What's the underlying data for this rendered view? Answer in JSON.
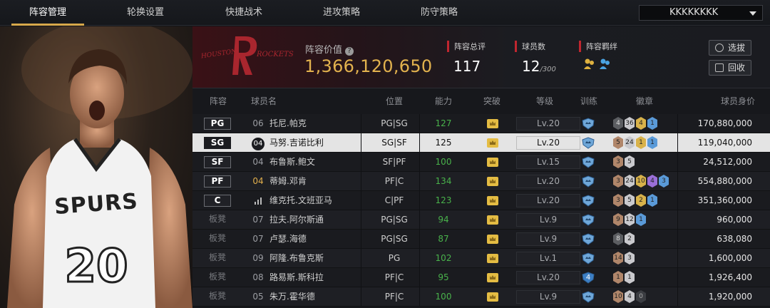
{
  "tabs": [
    {
      "label": "阵容管理",
      "active": true
    },
    {
      "label": "轮换设置",
      "active": false
    },
    {
      "label": "快捷战术",
      "active": false
    },
    {
      "label": "进攻策略",
      "active": false
    },
    {
      "label": "防守策略",
      "active": false
    }
  ],
  "team_select": {
    "value": "KKKKKKKK"
  },
  "header": {
    "value_label": "阵容价值",
    "value": "1,366,120,650",
    "rating_label": "阵容总评",
    "rating": "117",
    "count_label": "球员数",
    "count": "12",
    "count_max": "/300",
    "bond_label": "阵容羁绊",
    "select_button": "选拔",
    "return_button": "回收",
    "logo_text_left": "HOUSTON",
    "logo_text_right": "ROCKETS"
  },
  "player_art": {
    "jersey_text": "SPURS",
    "jersey_number": "20"
  },
  "table": {
    "columns": [
      "阵容",
      "球员名",
      "位置",
      "能力",
      "突破",
      "等级",
      "训练",
      "徽章",
      "球员身价"
    ],
    "rows": [
      {
        "slot": "PG",
        "num": "06",
        "name": "托尼.帕克",
        "pos": "PG|SG",
        "ability": "127",
        "level": "Lv.20",
        "train": "",
        "badges": [
          [
            "gray",
            "4"
          ],
          [
            "silver",
            "36"
          ],
          [
            "gold",
            "4"
          ],
          [
            "blue",
            "1"
          ]
        ],
        "price": "170,880,000"
      },
      {
        "slot": "SG",
        "num": "04",
        "name": "马努.吉诺比利",
        "pos": "SG|SF",
        "ability": "125",
        "level": "Lv.20",
        "train": "",
        "badges": [
          [
            "bronze",
            "5"
          ],
          [
            "silver",
            "24"
          ],
          [
            "gold",
            "1"
          ],
          [
            "blue",
            "1"
          ]
        ],
        "price": "119,040,000"
      },
      {
        "slot": "SF",
        "num": "04",
        "name": "布鲁斯.鲍文",
        "pos": "SF|PF",
        "ability": "100",
        "level": "Lv.15",
        "train": "",
        "badges": [
          [
            "bronze",
            "3"
          ],
          [
            "silver",
            "5"
          ]
        ],
        "price": "24,512,000"
      },
      {
        "slot": "PF",
        "num": "04",
        "name": "蒂姆.邓肯",
        "pos": "PF|C",
        "ability": "134",
        "level": "Lv.20",
        "train": "",
        "badges": [
          [
            "bronze",
            "3"
          ],
          [
            "silver",
            "24"
          ],
          [
            "gold",
            "10"
          ],
          [
            "purple",
            "4"
          ],
          [
            "blue",
            "3"
          ]
        ],
        "price": "554,880,000"
      },
      {
        "slot": "C",
        "num": "",
        "name": "维克托.文班亚马",
        "pos": "C|PF",
        "ability": "123",
        "level": "Lv.20",
        "train": "",
        "badges": [
          [
            "bronze",
            "3"
          ],
          [
            "silver",
            "5"
          ],
          [
            "gold",
            "2"
          ],
          [
            "blue",
            "1"
          ]
        ],
        "price": "351,360,000"
      },
      {
        "slot": "板凳",
        "num": "07",
        "name": "拉夫.阿尔斯通",
        "pos": "PG|SG",
        "ability": "94",
        "level": "Lv.9",
        "train": "",
        "badges": [
          [
            "bronze",
            "9"
          ],
          [
            "silver",
            "12"
          ],
          [
            "blue",
            "1"
          ]
        ],
        "price": "960,000"
      },
      {
        "slot": "板凳",
        "num": "07",
        "name": "卢瑟.海德",
        "pos": "PG|SG",
        "ability": "87",
        "level": "Lv.9",
        "train": "",
        "badges": [
          [
            "gray",
            "8"
          ],
          [
            "silver",
            "2"
          ]
        ],
        "price": "638,080"
      },
      {
        "slot": "板凳",
        "num": "09",
        "name": "阿隆.布鲁克斯",
        "pos": "PG",
        "ability": "102",
        "level": "Lv.1",
        "train": "",
        "badges": [
          [
            "bronze",
            "14"
          ],
          [
            "silver",
            "3"
          ]
        ],
        "price": "1,600,000"
      },
      {
        "slot": "板凳",
        "num": "08",
        "name": "路易斯.斯科拉",
        "pos": "PF|C",
        "ability": "95",
        "level": "Lv.20",
        "train": "4",
        "badges": [
          [
            "bronze",
            "1"
          ],
          [
            "silver",
            "1"
          ]
        ],
        "price": "1,926,400"
      },
      {
        "slot": "板凳",
        "num": "05",
        "name": "朱万.霍华德",
        "pos": "PF|C",
        "ability": "100",
        "level": "Lv.9",
        "train": "",
        "badges": [
          [
            "bronze",
            "10"
          ],
          [
            "silver",
            "4"
          ],
          [
            "dark",
            "0"
          ]
        ],
        "price": "1,920,000"
      }
    ]
  }
}
